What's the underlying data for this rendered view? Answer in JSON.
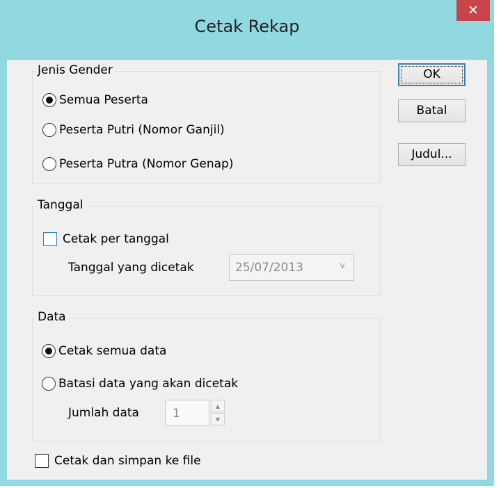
{
  "window": {
    "title": "Cetak Rekap",
    "close_glyph": "✕",
    "colors": {
      "titlebar": "#91d8e0",
      "close": "#c7444a",
      "client": "#f0f0f0"
    }
  },
  "buttons": {
    "ok": "OK",
    "cancel": "Batal",
    "title_setup": "Judul..."
  },
  "gender_group": {
    "legend": "Jenis Gender",
    "selected": "Semua Peserta",
    "options": [
      "Semua Peserta",
      "Peserta Putri (Nomor Ganjil)",
      "Peserta Putra (Nomor Genap)"
    ]
  },
  "date_group": {
    "legend": "Tanggal",
    "checkbox_label": "Cetak per tanggal",
    "checkbox_checked": false,
    "date_label": "Tanggal yang dicetak",
    "date_value": "25/07/2013",
    "dropdown_glyph": "v"
  },
  "data_group": {
    "legend": "Data",
    "selected": "Cetak semua data",
    "options": [
      "Cetak semua data",
      "Batasi data yang akan dicetak"
    ],
    "count_label": "Jumlah data",
    "count_value": "1",
    "spin_up_glyph": "▲",
    "spin_down_glyph": "▼"
  },
  "save_to_file": {
    "label": "Cetak dan simpan ke file",
    "checked": false
  }
}
